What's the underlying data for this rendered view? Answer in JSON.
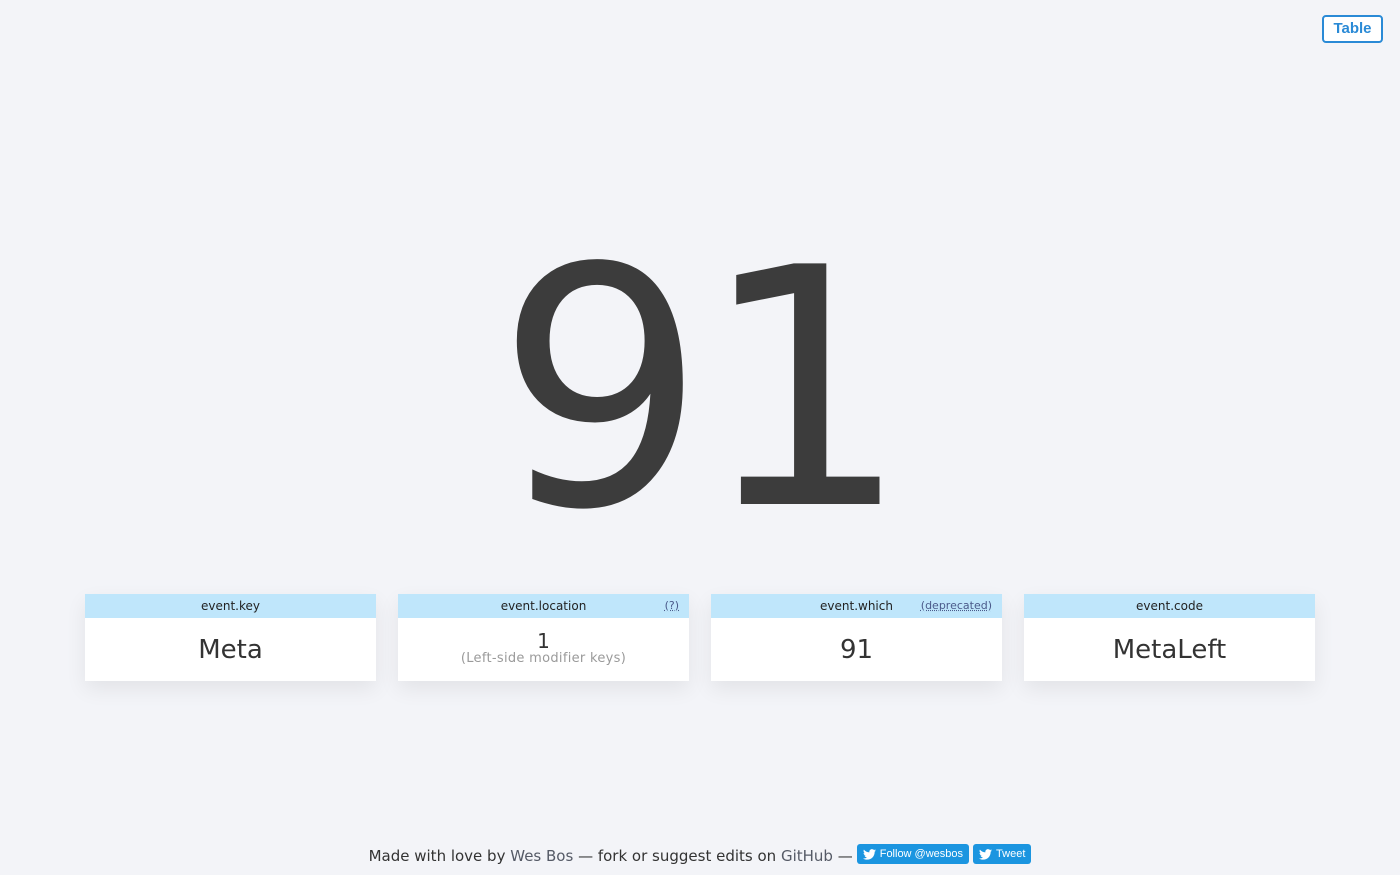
{
  "toggle": {
    "label": "Table"
  },
  "keycode": "91",
  "cards": [
    {
      "title": "event.key",
      "aside": "",
      "value": "Meta",
      "note": ""
    },
    {
      "title": "event.location",
      "aside": "(?)",
      "value": "1",
      "note": "(Left-side modifier keys)"
    },
    {
      "title": "event.which",
      "aside": "(deprecated)",
      "value": "91",
      "note": ""
    },
    {
      "title": "event.code",
      "aside": "",
      "value": "MetaLeft",
      "note": ""
    }
  ],
  "footer": {
    "prefix": "Made with love by",
    "author": "Wes Bos",
    "middle": "— fork or suggest edits on",
    "github": "GitHub",
    "dash": "—",
    "follow_label": "Follow @wesbos",
    "tweet_label": "Tweet"
  },
  "colors": {
    "background": "#f3f4f8",
    "accent": "#2a8ad6",
    "card_header": "#bfe6fb",
    "twitter": "#1b95e0"
  },
  "icons": {
    "twitter": "twitter-bird-icon"
  }
}
